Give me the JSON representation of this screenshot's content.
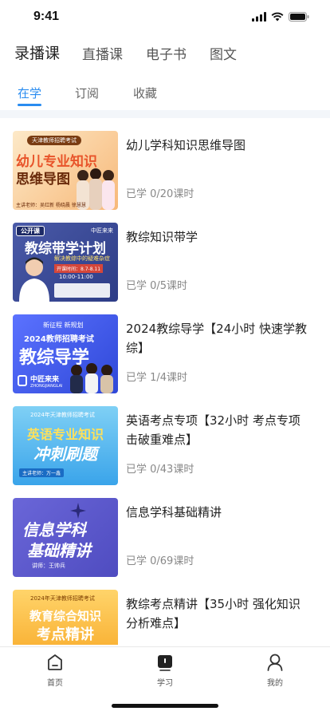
{
  "status": {
    "time": "9:41"
  },
  "top_tabs": [
    {
      "label": "录播课"
    },
    {
      "label": "直播课"
    },
    {
      "label": "电子书"
    },
    {
      "label": "图文"
    }
  ],
  "sub_tabs": [
    {
      "label": "在学"
    },
    {
      "label": "订阅"
    },
    {
      "label": "收藏"
    }
  ],
  "courses": [
    {
      "title": "幼儿学科知识思维导图",
      "progress": "已学 0/20课时",
      "cover": {
        "tag": "天津教师招聘考试",
        "line1": "幼儿专业知识",
        "line2": "思维导图",
        "foot": "主讲老师：吴红新 杨晓晨 徐慧慧"
      }
    },
    {
      "title": "教综知识带学",
      "progress": "已学 0/5课时",
      "cover": {
        "tag": "公开课",
        "brand": "中匠来来",
        "line1": "教综带学计划",
        "line2": "解决教综中的疑难杂症",
        "date": "开课时间：8.7-8.11",
        "time": "10:00-11:00"
      }
    },
    {
      "title": "2024教综导学【24小时 快速学教综】",
      "progress": "已学 1/4课时",
      "cover": {
        "tag": "新征程 新规划",
        "line1": "2024教师招聘考试",
        "line2": "教综导学",
        "brand": "中匠来来",
        "brand_en": "ZHONGJIANGLAI"
      }
    },
    {
      "title": "英语考点专项【32小时 考点专项击破重难点】",
      "progress": "已学 0/43课时",
      "cover": {
        "tag": "2024年天津教师招聘考试",
        "line1": "英语专业知识",
        "line2": "冲刺刷题",
        "foot": "主讲老师：万一鑫"
      }
    },
    {
      "title": "信息学科基础精讲",
      "progress": "已学 0/69课时",
      "cover": {
        "line1": "信息学科",
        "line2": "基础精讲",
        "foot": "讲师：王帅兵"
      }
    },
    {
      "title": "教综考点精讲【35小时 强化知识分析难点】",
      "progress": "",
      "cover": {
        "tag": "2024年天津教师招聘考试",
        "line1": "教育综合知识",
        "line2": "考点精讲"
      }
    }
  ],
  "bottom_nav": [
    {
      "label": "首页",
      "icon": "home-icon"
    },
    {
      "label": "学习",
      "icon": "study-icon"
    },
    {
      "label": "我的",
      "icon": "profile-icon"
    }
  ],
  "colors": {
    "accent": "#2a8cf0",
    "text": "#222222",
    "muted": "#888888"
  }
}
